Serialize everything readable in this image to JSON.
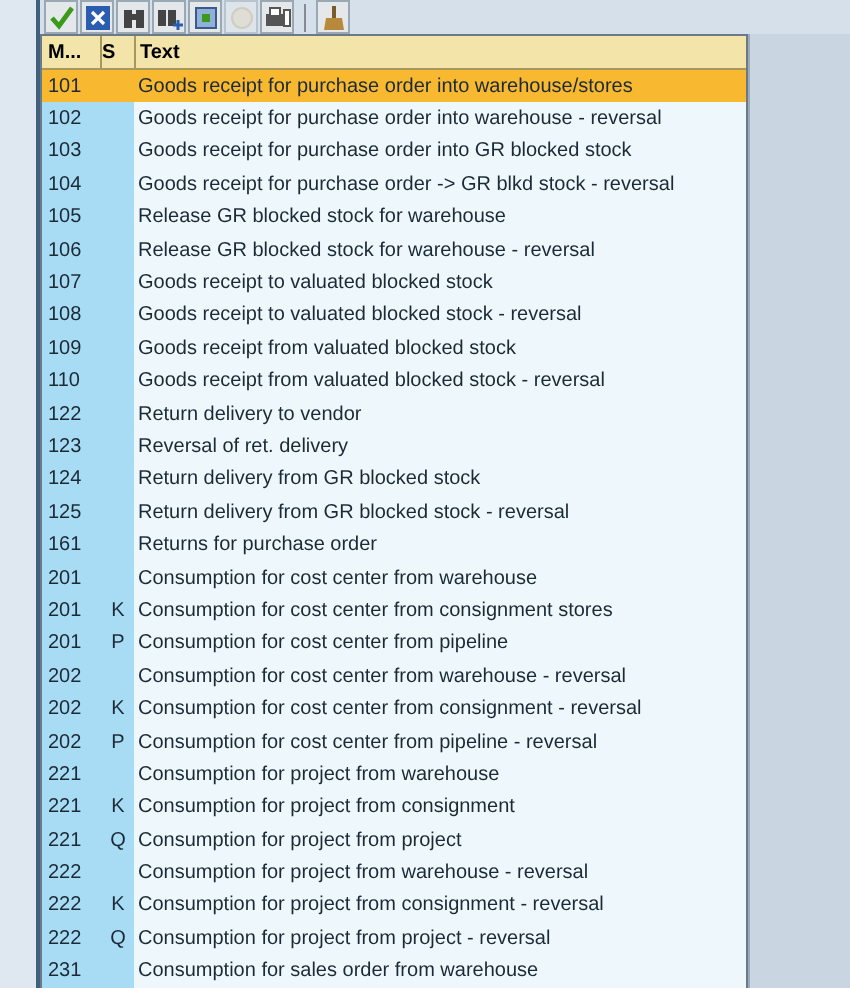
{
  "toolbar": [
    {
      "kind": "check"
    },
    {
      "kind": "cancel"
    },
    {
      "kind": "find"
    },
    {
      "kind": "find-next"
    },
    {
      "kind": "select"
    },
    {
      "kind": "disabled"
    },
    {
      "kind": "print"
    },
    {
      "kind": "sep"
    },
    {
      "kind": "brush"
    }
  ],
  "table": {
    "columns": [
      "M...",
      "S",
      "Text"
    ],
    "rows": [
      {
        "m": "101",
        "s": "",
        "text": "Goods receipt for purchase order into warehouse/stores",
        "selected": true
      },
      {
        "m": "102",
        "s": "",
        "text": "Goods receipt for purchase order into warehouse - reversal",
        "selected": false
      },
      {
        "m": "103",
        "s": "",
        "text": "Goods receipt for purchase order into GR blocked stock",
        "selected": false
      },
      {
        "m": "104",
        "s": "",
        "text": "Goods receipt for purchase order -> GR blkd stock - reversal",
        "selected": false
      },
      {
        "m": "105",
        "s": "",
        "text": "Release GR blocked stock for warehouse",
        "selected": false
      },
      {
        "m": "106",
        "s": "",
        "text": "Release GR blocked stock for warehouse - reversal",
        "selected": false
      },
      {
        "m": "107",
        "s": "",
        "text": "Goods receipt to valuated blocked stock",
        "selected": false
      },
      {
        "m": "108",
        "s": "",
        "text": "Goods receipt to valuated blocked stock - reversal",
        "selected": false
      },
      {
        "m": "109",
        "s": "",
        "text": "Goods receipt from valuated blocked stock",
        "selected": false
      },
      {
        "m": "110",
        "s": "",
        "text": "Goods receipt from valuated blocked stock - reversal",
        "selected": false
      },
      {
        "m": "122",
        "s": "",
        "text": "Return delivery to vendor",
        "selected": false
      },
      {
        "m": "123",
        "s": "",
        "text": "Reversal of ret. delivery",
        "selected": false
      },
      {
        "m": "124",
        "s": "",
        "text": "Return delivery from GR blocked stock",
        "selected": false
      },
      {
        "m": "125",
        "s": "",
        "text": "Return delivery from GR blocked stock - reversal",
        "selected": false
      },
      {
        "m": "161",
        "s": "",
        "text": "Returns for purchase order",
        "selected": false
      },
      {
        "m": "201",
        "s": "",
        "text": "Consumption for cost center from warehouse",
        "selected": false
      },
      {
        "m": "201",
        "s": "K",
        "text": "Consumption for cost center from consignment stores",
        "selected": false
      },
      {
        "m": "201",
        "s": "P",
        "text": "Consumption for cost center from pipeline",
        "selected": false
      },
      {
        "m": "202",
        "s": "",
        "text": "Consumption for cost center from warehouse - reversal",
        "selected": false
      },
      {
        "m": "202",
        "s": "K",
        "text": "Consumption for cost center from consignment - reversal",
        "selected": false
      },
      {
        "m": "202",
        "s": "P",
        "text": "Consumption for cost center from pipeline - reversal",
        "selected": false
      },
      {
        "m": "221",
        "s": "",
        "text": "Consumption for project from warehouse",
        "selected": false
      },
      {
        "m": "221",
        "s": "K",
        "text": "Consumption for project from consignment",
        "selected": false
      },
      {
        "m": "221",
        "s": "Q",
        "text": "Consumption for project from project",
        "selected": false
      },
      {
        "m": "222",
        "s": "",
        "text": "Consumption for project from warehouse - reversal",
        "selected": false
      },
      {
        "m": "222",
        "s": "K",
        "text": "Consumption for project from consignment - reversal",
        "selected": false
      },
      {
        "m": "222",
        "s": "Q",
        "text": "Consumption for project from project - reversal",
        "selected": false
      },
      {
        "m": "231",
        "s": "",
        "text": "Consumption for sales order from warehouse",
        "selected": false
      }
    ]
  }
}
